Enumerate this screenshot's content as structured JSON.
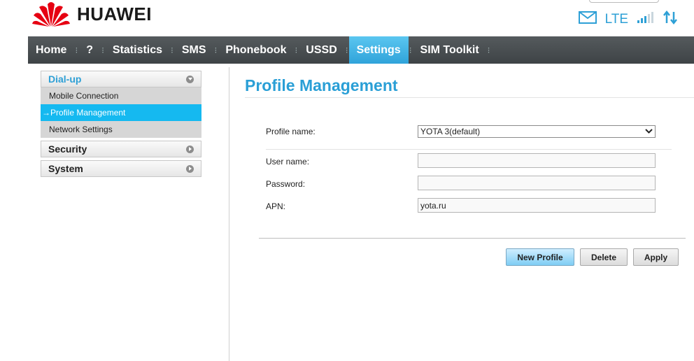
{
  "brand": {
    "name": "HUAWEI"
  },
  "status": {
    "network": "LTE"
  },
  "nav": {
    "items": [
      {
        "label": "Home"
      },
      {
        "label": "?"
      },
      {
        "label": "Statistics"
      },
      {
        "label": "SMS"
      },
      {
        "label": "Phonebook"
      },
      {
        "label": "USSD"
      },
      {
        "label": "Settings",
        "active": true
      },
      {
        "label": "SIM Toolkit"
      }
    ],
    "separator": "⁝"
  },
  "sidebar": {
    "groups": [
      {
        "label": "Dial-up",
        "open": true,
        "items": [
          {
            "label": "Mobile Connection"
          },
          {
            "label": "→Profile Management",
            "active": true
          },
          {
            "label": "Network Settings"
          }
        ]
      },
      {
        "label": "Security",
        "open": false
      },
      {
        "label": "System",
        "open": false
      }
    ]
  },
  "main": {
    "title": "Profile Management",
    "form": {
      "profile_label": "Profile name:",
      "profile_value": "YOTA 3(default)",
      "username_label": "User name:",
      "username_value": "",
      "password_label": "Password:",
      "password_value": "",
      "apn_label": "APN:",
      "apn_value": "yota.ru"
    },
    "buttons": {
      "new_profile": "New Profile",
      "delete": "Delete",
      "apply": "Apply"
    }
  },
  "colors": {
    "accent": "#2ea0d6",
    "active_tab": "#3db1e6",
    "nav_bg": "#4a4f52",
    "brand_red": "#e60012"
  }
}
